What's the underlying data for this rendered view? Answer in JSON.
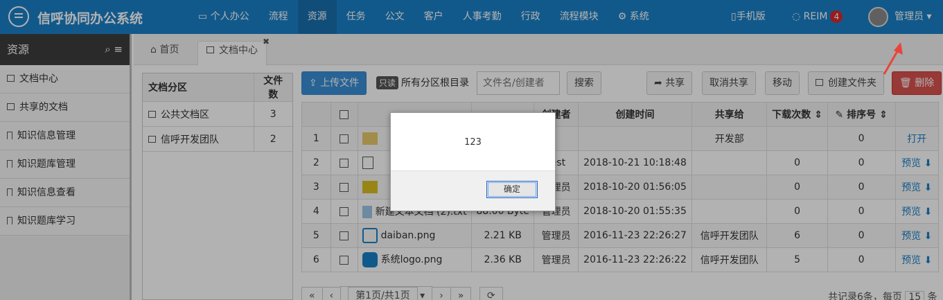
{
  "app": {
    "title": "信呼协同办公系统"
  },
  "nav": {
    "items": [
      {
        "label": "个人办公",
        "icon": "monitor-icon"
      },
      {
        "label": "流程"
      },
      {
        "label": "资源",
        "active": true
      },
      {
        "label": "任务"
      },
      {
        "label": "公文"
      },
      {
        "label": "客户"
      },
      {
        "label": "人事考勤"
      },
      {
        "label": "行政"
      },
      {
        "label": "流程模块"
      },
      {
        "label": "系统",
        "icon": "gear-icon"
      }
    ],
    "mobile": "手机版",
    "reim": "REIM",
    "reim_badge": "4",
    "user": "管理员"
  },
  "sidebar": {
    "title": "资源",
    "items": [
      {
        "label": "文档中心",
        "icon": "folder-icon"
      },
      {
        "label": "共享的文档",
        "icon": "folder-open-icon"
      },
      {
        "label": "知识信息管理",
        "icon": "bookmark-icon"
      },
      {
        "label": "知识题库管理",
        "icon": "bookmark-icon"
      },
      {
        "label": "知识信息查看",
        "icon": "bookmark-icon"
      },
      {
        "label": "知识题库学习",
        "icon": "bookmark-icon"
      }
    ]
  },
  "tabs": [
    {
      "label": "首页",
      "icon": "home-icon"
    },
    {
      "label": "文档中心",
      "icon": "folder-icon",
      "active": true
    }
  ],
  "categories": {
    "header_name": "文档分区",
    "header_count": "文件数",
    "rows": [
      {
        "name": "公共文档区",
        "count": "3"
      },
      {
        "name": "信呼开发团队",
        "count": "2"
      }
    ]
  },
  "toolbar": {
    "upload": "上传文件",
    "readonly": "只读",
    "root": "所有分区根目录",
    "search_placeholder": "文件名/创建者",
    "search": "搜索",
    "share": "共享",
    "unshare": "取消共享",
    "move": "移动",
    "new_folder": "创建文件夹",
    "delete": "删除"
  },
  "files": {
    "headers": {
      "creator": "创建者",
      "created": "创建时间",
      "shared_to": "共享给",
      "downloads": "下载次数",
      "order": "排序号"
    },
    "rows": [
      {
        "no": "1",
        "name": "",
        "size": "",
        "creator": "",
        "created": "",
        "shared_to": "开发部",
        "downloads": "",
        "order": "0",
        "action": "打开",
        "icon": "folder-icon"
      },
      {
        "no": "2",
        "name": "",
        "size": "",
        "creator": "test",
        "created": "2018-10-21 10:18:48",
        "shared_to": "",
        "downloads": "0",
        "order": "0",
        "action": "预览",
        "icon": "file-icon"
      },
      {
        "no": "3",
        "name": "",
        "size": "",
        "creator": "管理员",
        "created": "2018-10-20 01:56:05",
        "shared_to": "",
        "downloads": "0",
        "order": "0",
        "action": "预览",
        "icon": "php-file-icon"
      },
      {
        "no": "4",
        "name": "新建文本文档 (2).txt",
        "size": "88.00 Byte",
        "creator": "管理员",
        "created": "2018-10-20 01:55:35",
        "shared_to": "",
        "downloads": "0",
        "order": "0",
        "action": "预览",
        "icon": "text-file-icon"
      },
      {
        "no": "5",
        "name": "daiban.png",
        "size": "2.21 KB",
        "creator": "管理员",
        "created": "2016-11-23 22:26:27",
        "shared_to": "信呼开发团队",
        "downloads": "6",
        "order": "0",
        "action": "预览",
        "icon": "image-file-icon"
      },
      {
        "no": "6",
        "name": "系统logo.png",
        "size": "2.36 KB",
        "creator": "管理员",
        "created": "2016-11-23 22:26:22",
        "shared_to": "信呼开发团队",
        "downloads": "5",
        "order": "0",
        "action": "预览",
        "icon": "chat-logo-icon"
      }
    ]
  },
  "pager": {
    "page": "第1页/共1页",
    "summary": "共记录6条，每页",
    "per_page": "15",
    "unit": "条"
  },
  "dialog": {
    "message": "123",
    "ok": "确定"
  },
  "colors": {
    "topbar": "#1a80c8",
    "danger": "#d9534f",
    "primary": "#3a8fd6",
    "arrow": "#e8443a"
  }
}
